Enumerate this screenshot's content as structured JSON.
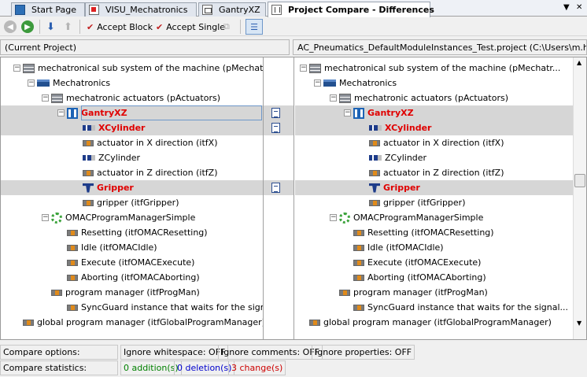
{
  "tabs": [
    {
      "label": "Start Page",
      "icon": "start-page-icon"
    },
    {
      "label": "VISU_Mechatronics",
      "icon": "visu-icon"
    },
    {
      "label": "GantryXZ",
      "icon": "gantry-tab-icon"
    },
    {
      "label": "Project Compare - Differences",
      "icon": "compare-icon"
    }
  ],
  "tab_controls": {
    "dropdown": "▼",
    "close": "✕"
  },
  "toolbar": {
    "accept_block": "Accept Block",
    "accept_single": "Accept Single"
  },
  "projects": {
    "left": "(Current Project)",
    "right": "AC_Pneumatics_DefaultModuleInstances_Test.project  (C:\\Users\\m.ha..."
  },
  "left_tree": [
    {
      "label": "mechatronical sub system of the machine (pMechatronics)",
      "icon": "list",
      "changed": false
    },
    {
      "label": "Mechatronics",
      "icon": "module",
      "changed": false
    },
    {
      "label": "mechatronic actuators (pActuators)",
      "icon": "list",
      "changed": false
    },
    {
      "label": "GantryXZ",
      "icon": "gantry",
      "changed": true
    },
    {
      "label": "XCylinder",
      "icon": "cylinder",
      "changed": true
    },
    {
      "label": "actuator in X direction (itfX)",
      "icon": "interface",
      "changed": false
    },
    {
      "label": "ZCylinder",
      "icon": "cylinder",
      "changed": false
    },
    {
      "label": "actuator in Z direction (itfZ)",
      "icon": "interface",
      "changed": false
    },
    {
      "label": "Gripper",
      "icon": "gripper",
      "changed": true
    },
    {
      "label": "gripper (itfGripper)",
      "icon": "interface",
      "changed": false
    },
    {
      "label": "OMACProgramManagerSimple",
      "icon": "omac",
      "changed": false
    },
    {
      "label": "Resetting (itfOMACResetting)",
      "icon": "interface",
      "changed": false
    },
    {
      "label": "Idle (itfOMACIdle)",
      "icon": "interface",
      "changed": false
    },
    {
      "label": "Execute (itfOMACExecute)",
      "icon": "interface",
      "changed": false
    },
    {
      "label": "Aborting (itfOMACAborting)",
      "icon": "interface",
      "changed": false
    },
    {
      "label": "program manager (itfProgMan)",
      "icon": "interface",
      "changed": false
    },
    {
      "label": "SyncGuard instance that waits for the signal...",
      "icon": "interface",
      "changed": false
    },
    {
      "label": "global program manager (itfGlobalProgramManager)",
      "icon": "interface",
      "changed": false
    }
  ],
  "right_tree": [
    {
      "label": "mechatronical sub system of the machine (pMechatr...",
      "icon": "list",
      "changed": false
    },
    {
      "label": "Mechatronics",
      "icon": "module",
      "changed": false
    },
    {
      "label": "mechatronic actuators (pActuators)",
      "icon": "list",
      "changed": false
    },
    {
      "label": "GantryXZ",
      "icon": "gantry",
      "changed": true
    },
    {
      "label": "XCylinder",
      "icon": "cylinder",
      "changed": true
    },
    {
      "label": "actuator in X direction (itfX)",
      "icon": "interface",
      "changed": false
    },
    {
      "label": "ZCylinder",
      "icon": "cylinder",
      "changed": false
    },
    {
      "label": "actuator in Z direction (itfZ)",
      "icon": "interface",
      "changed": false
    },
    {
      "label": "Gripper",
      "icon": "gripper",
      "changed": true
    },
    {
      "label": "gripper (itfGripper)",
      "icon": "interface",
      "changed": false
    },
    {
      "label": "OMACProgramManagerSimple",
      "icon": "omac",
      "changed": false
    },
    {
      "label": "Resetting (itfOMACResetting)",
      "icon": "interface",
      "changed": false
    },
    {
      "label": "Idle (itfOMACIdle)",
      "icon": "interface",
      "changed": false
    },
    {
      "label": "Execute (itfOMACExecute)",
      "icon": "interface",
      "changed": false
    },
    {
      "label": "Aborting (itfOMACAborting)",
      "icon": "interface",
      "changed": false
    },
    {
      "label": "program manager (itfProgMan)",
      "icon": "interface",
      "changed": false
    },
    {
      "label": "SyncGuard instance that waits for the signal...",
      "icon": "interface",
      "changed": false
    },
    {
      "label": "global program manager (itfGlobalProgramManager)",
      "icon": "interface",
      "changed": false
    }
  ],
  "compare_options": {
    "label": "Compare options:",
    "whitespace": "Ignore whitespace: OFF",
    "comments": "Ignore comments: OFF",
    "properties": "Ignore properties: OFF"
  },
  "compare_statistics": {
    "label": "Compare statistics:",
    "additions": "0 addition(s)",
    "deletions": "0 deletion(s)",
    "changes": "3 change(s)"
  },
  "colors": {
    "changed_text": "#e00000",
    "changed_row_bg": "#d6d6d6",
    "additions": "#008000",
    "deletions": "#0000cc",
    "changes": "#cc0000"
  }
}
